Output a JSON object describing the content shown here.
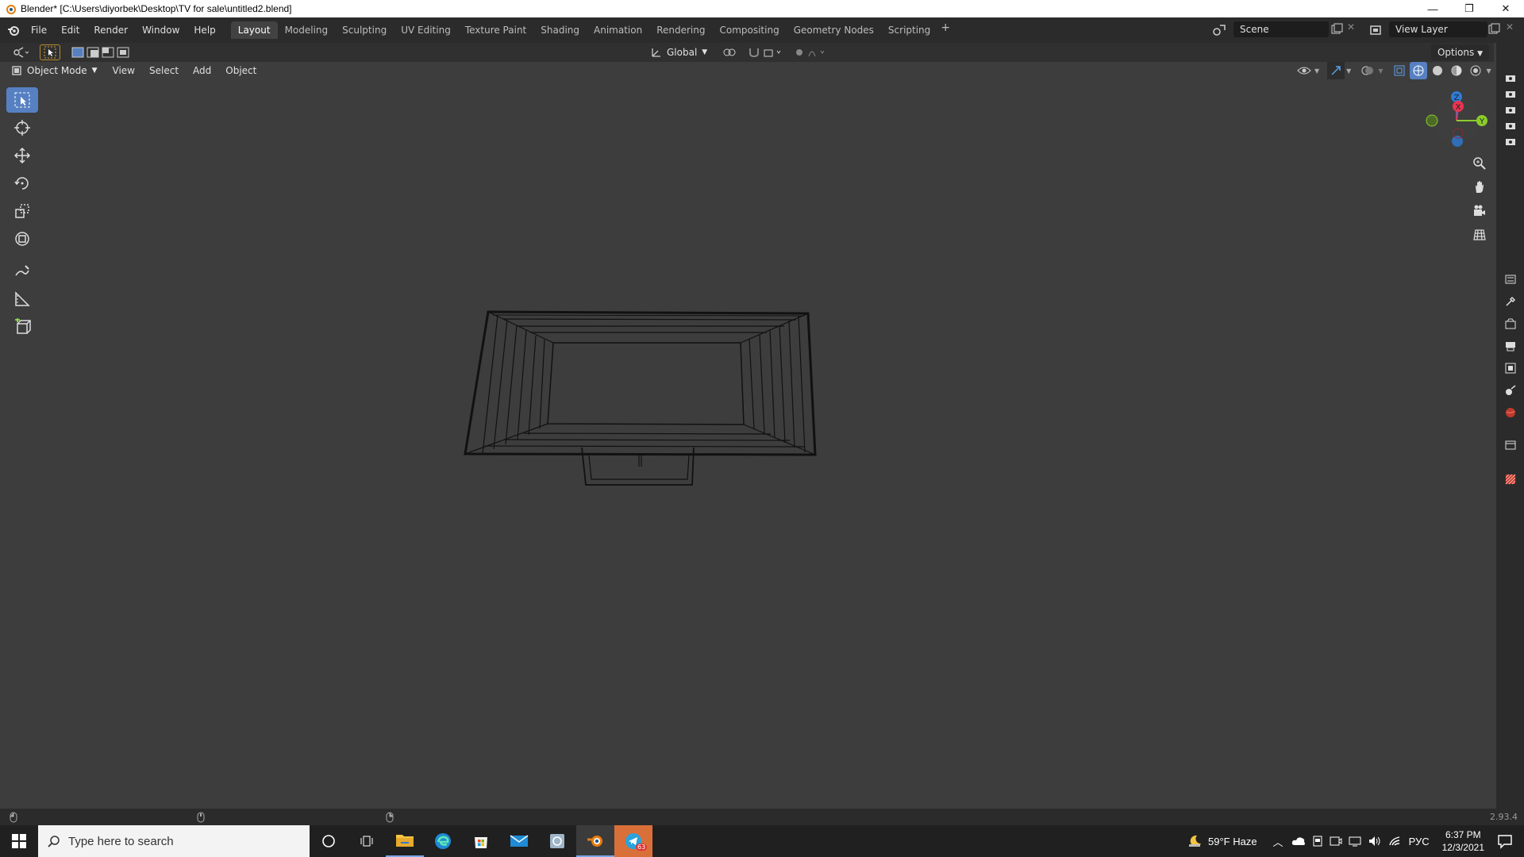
{
  "window": {
    "title": "Blender* [C:\\Users\\diyorbek\\Desktop\\TV for sale\\untitled2.blend]",
    "minimize": "—",
    "restore": "❐",
    "close": "✕"
  },
  "menu": [
    "File",
    "Edit",
    "Render",
    "Window",
    "Help"
  ],
  "workspaces": [
    "Layout",
    "Modeling",
    "Sculpting",
    "UV Editing",
    "Texture Paint",
    "Shading",
    "Animation",
    "Rendering",
    "Compositing",
    "Geometry Nodes",
    "Scripting"
  ],
  "workspace_add": "+",
  "scene": {
    "label": "Scene",
    "view_layer": "View Layer"
  },
  "header": {
    "orientation": "Global",
    "options": "Options"
  },
  "viewport_header": {
    "mode": "Object Mode",
    "menus": [
      "View",
      "Select",
      "Add",
      "Object"
    ]
  },
  "gizmo": {
    "x": "X",
    "y": "Y",
    "z": "Z"
  },
  "status": {
    "version": "2.93.4"
  },
  "taskbar": {
    "search_placeholder": "Type here to search",
    "weather": "59°F  Haze",
    "lang": "РУС",
    "time": "6:37 PM",
    "date": "12/3/2021",
    "telegram_badge": "63"
  },
  "colors": {
    "accent": "#5680c2",
    "viewport_bg": "#3d3d3d",
    "axis_x": "#e8344f",
    "axis_y": "#8bcc2b",
    "axis_z": "#2d7bd6"
  }
}
